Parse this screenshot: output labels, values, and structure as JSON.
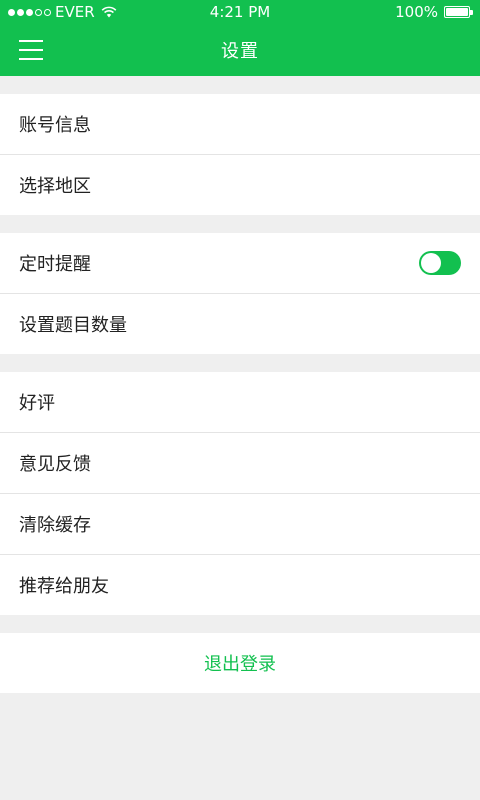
{
  "status_bar": {
    "carrier": "EVER",
    "time": "4:21 PM",
    "battery_text": "100%",
    "battery_level": 1.0,
    "signal_filled": 3,
    "signal_total": 5
  },
  "navbar": {
    "title": "设置",
    "menu_icon": "hamburger-menu-icon"
  },
  "groups": [
    {
      "items": [
        {
          "label": "账号信息"
        },
        {
          "label": "选择地区"
        }
      ]
    },
    {
      "items": [
        {
          "label": "定时提醒",
          "toggle": true,
          "toggle_on": true
        },
        {
          "label": "设置题目数量"
        }
      ]
    },
    {
      "items": [
        {
          "label": "好评"
        },
        {
          "label": "意见反馈"
        },
        {
          "label": "清除缓存"
        },
        {
          "label": "推荐给朋友"
        }
      ]
    }
  ],
  "logout_label": "退出登录",
  "colors": {
    "accent": "#12c04f",
    "background": "#efefef"
  }
}
